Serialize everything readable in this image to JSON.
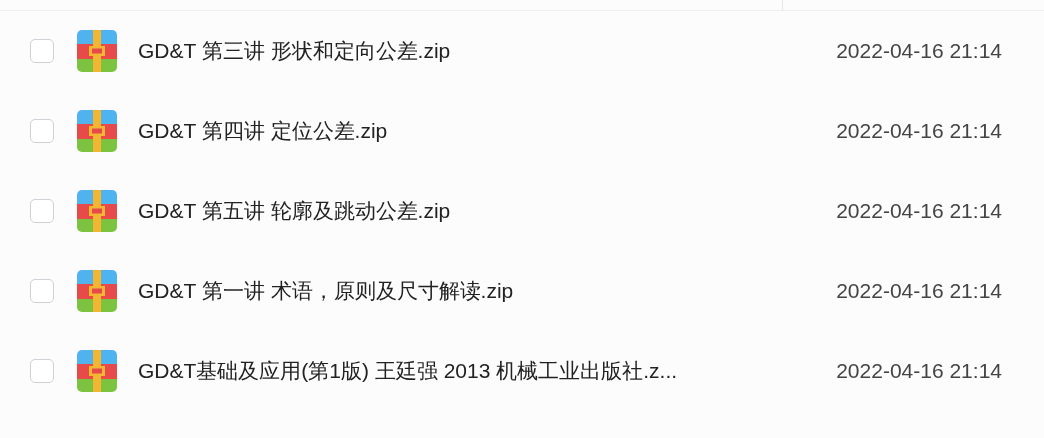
{
  "files": [
    {
      "name": "GD&T 第三讲 形状和定向公差.zip",
      "modified": "2022-04-16 21:14",
      "checked": false
    },
    {
      "name": "GD&T 第四讲 定位公差.zip",
      "modified": "2022-04-16 21:14",
      "checked": false
    },
    {
      "name": "GD&T 第五讲 轮廓及跳动公差.zip",
      "modified": "2022-04-16 21:14",
      "checked": false
    },
    {
      "name": "GD&T 第一讲 术语，原则及尺寸解读.zip",
      "modified": "2022-04-16 21:14",
      "checked": false
    },
    {
      "name": "GD&T基础及应用(第1版) 王廷强 2013 机械工业出版社.z...",
      "modified": "2022-04-16 21:14",
      "checked": false
    }
  ]
}
